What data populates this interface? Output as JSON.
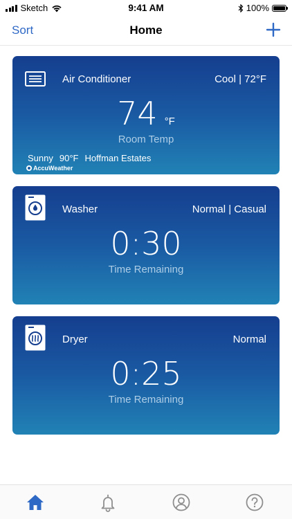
{
  "status_bar": {
    "carrier": "Sketch",
    "time": "9:41 AM",
    "battery": "100%"
  },
  "nav": {
    "sort_label": "Sort",
    "title": "Home",
    "add_icon": "plus-icon"
  },
  "colors": {
    "accent": "#2f69c6",
    "card_gradient_top": "#153e8f",
    "card_gradient_bottom": "#2182b5",
    "sub_label": "#aecde6"
  },
  "devices": {
    "air_conditioner": {
      "icon": "air-conditioner-icon",
      "name": "Air Conditioner",
      "mode": "Cool | 72°F",
      "temp": "74",
      "unit": "°F",
      "label": "Room Temp",
      "weather": {
        "condition": "Sunny",
        "temp": "90°F",
        "location": "Hoffman Estates",
        "provider": "AccuWeather"
      }
    },
    "washer": {
      "icon": "washer-icon",
      "name": "Washer",
      "mode": "Normal | Casual",
      "time": "0:30",
      "label": "Time Remaining"
    },
    "dryer": {
      "icon": "dryer-icon",
      "name": "Dryer",
      "mode": "Normal",
      "time": "0:25",
      "label": "Time Remaining"
    }
  },
  "tab_bar": {
    "tabs": [
      {
        "icon": "home-icon",
        "active": true
      },
      {
        "icon": "bell-icon",
        "active": false
      },
      {
        "icon": "account-icon",
        "active": false
      },
      {
        "icon": "help-icon",
        "active": false
      }
    ]
  }
}
